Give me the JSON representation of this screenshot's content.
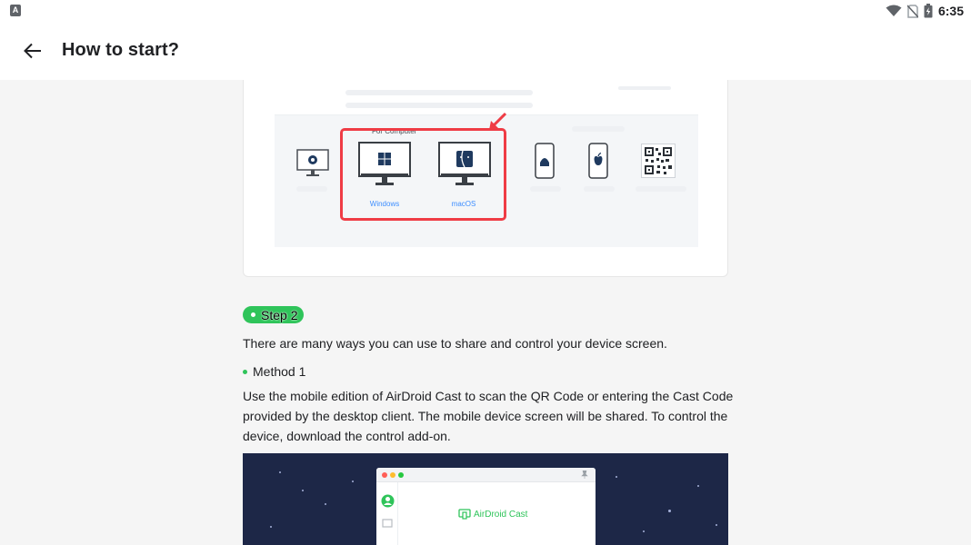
{
  "status_bar": {
    "app_icon_letter": "A",
    "time": "6:35",
    "icons": [
      "wifi-icon",
      "no-sim-icon",
      "battery-charging-icon"
    ]
  },
  "app_bar": {
    "back_icon": "arrow-left-icon",
    "title": "How to start?"
  },
  "figure1": {
    "section_label": "For Computer",
    "devices": [
      {
        "name": "web",
        "icon": "browser-icon"
      },
      {
        "name": "Windows",
        "icon": "windows-icon",
        "label": "Windows"
      },
      {
        "name": "macOS",
        "icon": "finder-icon",
        "label": "macOS"
      },
      {
        "name": "android",
        "icon": "android-icon"
      },
      {
        "name": "ios",
        "icon": "apple-icon"
      },
      {
        "name": "qr",
        "icon": "qr-code-icon"
      }
    ],
    "highlight_color": "#ef3c45",
    "label_color": "#3d8eff"
  },
  "step": {
    "label": "Step 2",
    "color": "#2fc45a"
  },
  "intro_text": "There are many ways you can use to share and control your device screen.",
  "method": {
    "title": "Method 1",
    "description": "Use the mobile edition of AirDroid Cast to scan the QR Code or entering the Cast Code provided by the desktop client. The mobile device screen will be shared. To control the device, download the control add-on."
  },
  "figure2": {
    "brand": "AirDroid Cast",
    "background": "#1d2747"
  }
}
